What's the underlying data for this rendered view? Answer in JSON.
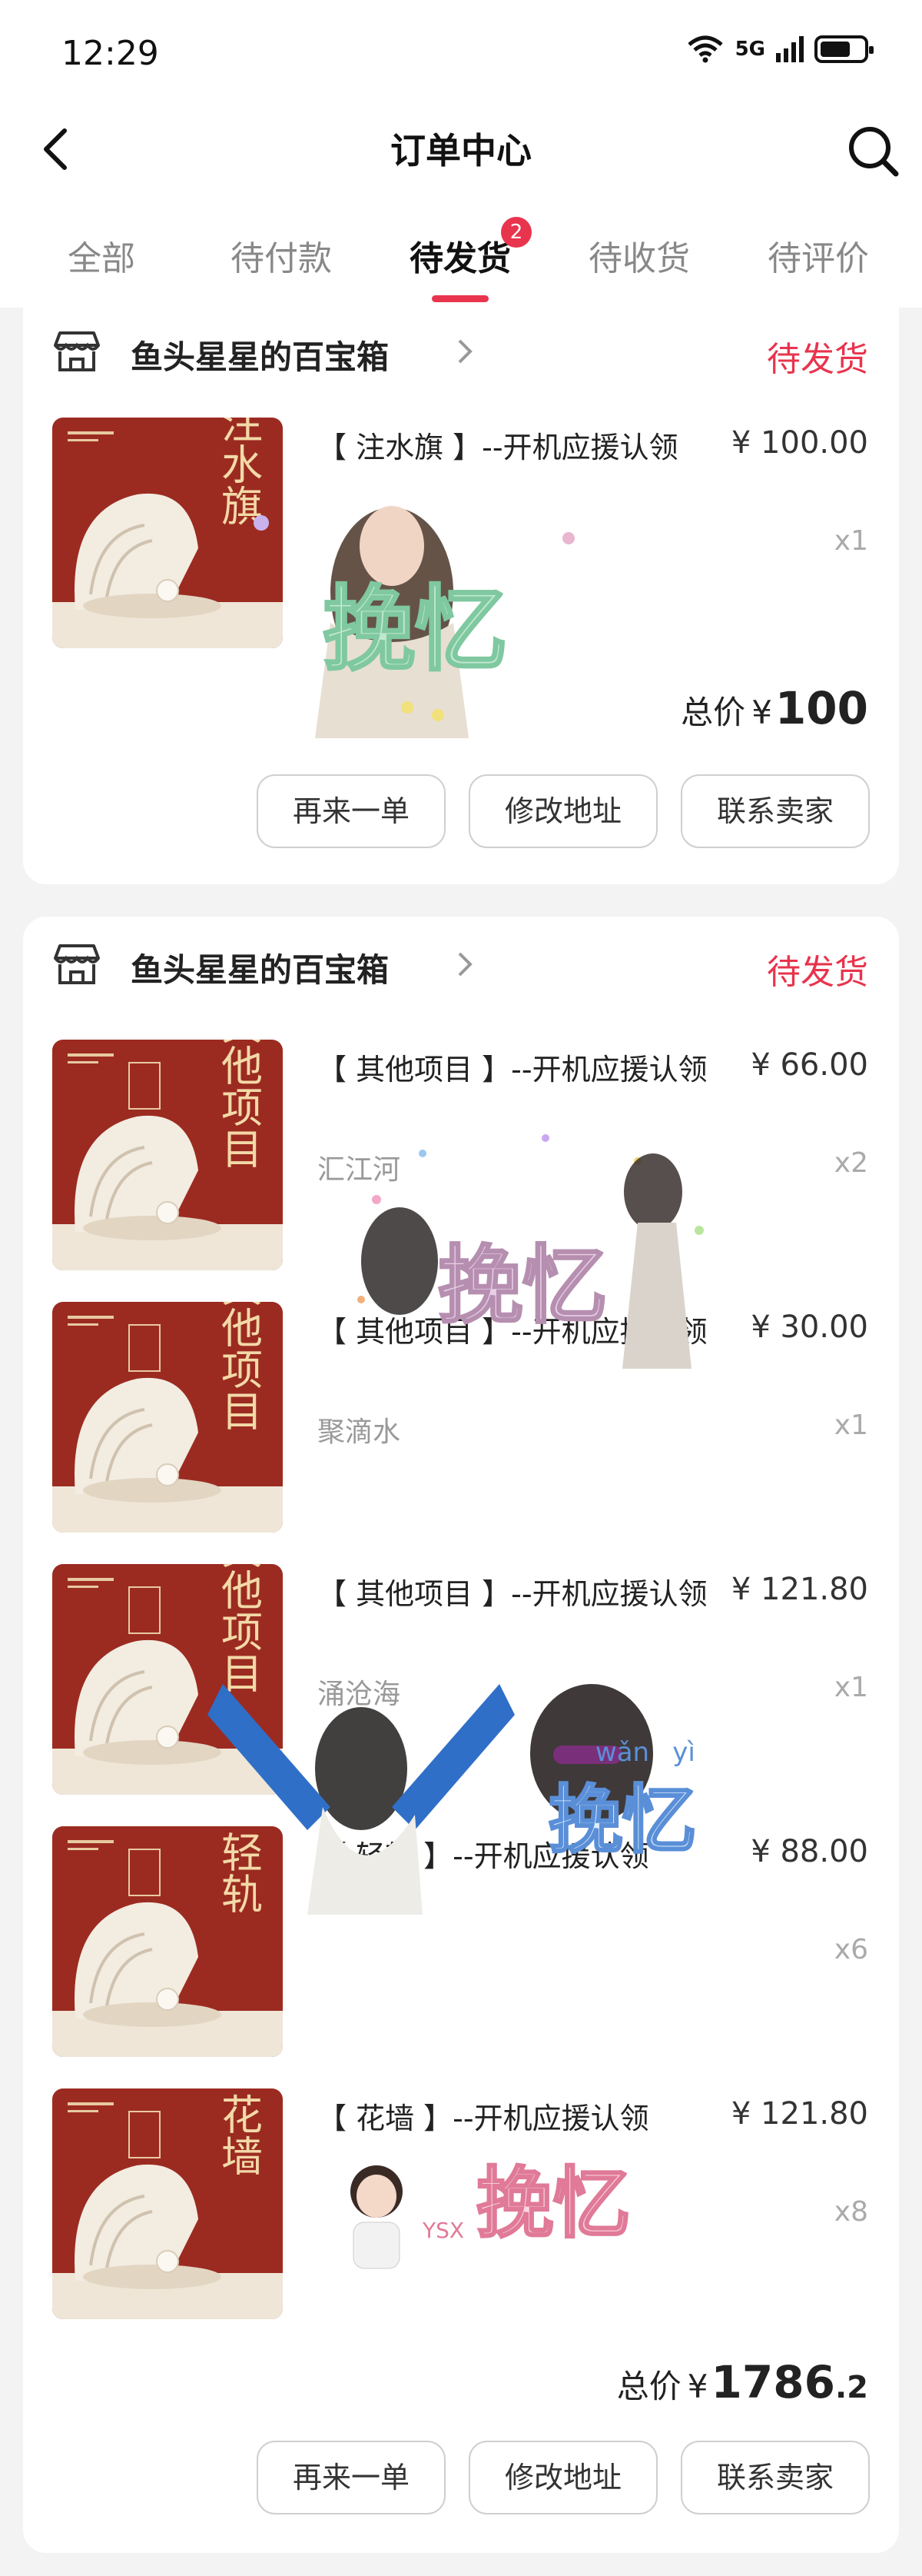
{
  "status_bar": {
    "time": "12:29",
    "network": "5G"
  },
  "header": {
    "title": "订单中心"
  },
  "tabs": [
    {
      "label": "全部"
    },
    {
      "label": "待付款"
    },
    {
      "label": "待发货",
      "badge": "2"
    },
    {
      "label": "待收货"
    },
    {
      "label": "待评价"
    }
  ],
  "orders": [
    {
      "shop": "鱼头星星的百宝箱",
      "status": "待发货",
      "items": [
        {
          "title": "【 注水旗 】--开机应援认领",
          "price": "¥ 100.00",
          "spec": "",
          "qty": "x1",
          "thumb_text": "注水旗"
        }
      ],
      "total_label": "总价",
      "total_yen": "¥",
      "total_int": "100",
      "total_dec": "",
      "buttons": [
        "再来一单",
        "修改地址",
        "联系卖家"
      ]
    },
    {
      "shop": "鱼头星星的百宝箱",
      "status": "待发货",
      "items": [
        {
          "title": "【 其他项目 】--开机应援认领",
          "price": "¥ 66.00",
          "spec": "汇江河",
          "qty": "x2",
          "thumb_text": "其他项目"
        },
        {
          "title": "【 其他项目 】--开机应援认领",
          "price": "¥ 30.00",
          "spec": "聚滴水",
          "qty": "x1",
          "thumb_text": "其他项目"
        },
        {
          "title": "【 其他项目 】--开机应援认领",
          "price": "¥ 121.80",
          "spec": "涌沧海",
          "qty": "x1",
          "thumb_text": "其他项目"
        },
        {
          "title": "【 轻轨 】--开机应援认领",
          "price": "¥ 88.00",
          "spec": "",
          "qty": "x6",
          "thumb_text": "轻轨"
        },
        {
          "title": "【 花墙 】--开机应援认领",
          "price": "¥ 121.80",
          "spec": "",
          "qty": "x8",
          "thumb_text": "花墙"
        }
      ],
      "total_label": "总价",
      "total_yen": "¥",
      "total_int": "1786",
      "total_dec": ".2",
      "buttons": [
        "再来一单",
        "修改地址",
        "联系卖家"
      ]
    }
  ],
  "stickers": [
    "挽忆",
    "挽忆",
    "挽忆",
    "挽忆"
  ],
  "sticker_pinyin": [
    "wǎn",
    "yì"
  ],
  "sticker_tag": "YSX",
  "colors": {
    "accent": "#e8344d",
    "card": "#ffffff",
    "background": "#f3f3f3",
    "thumb_red": "#9b2b21"
  }
}
